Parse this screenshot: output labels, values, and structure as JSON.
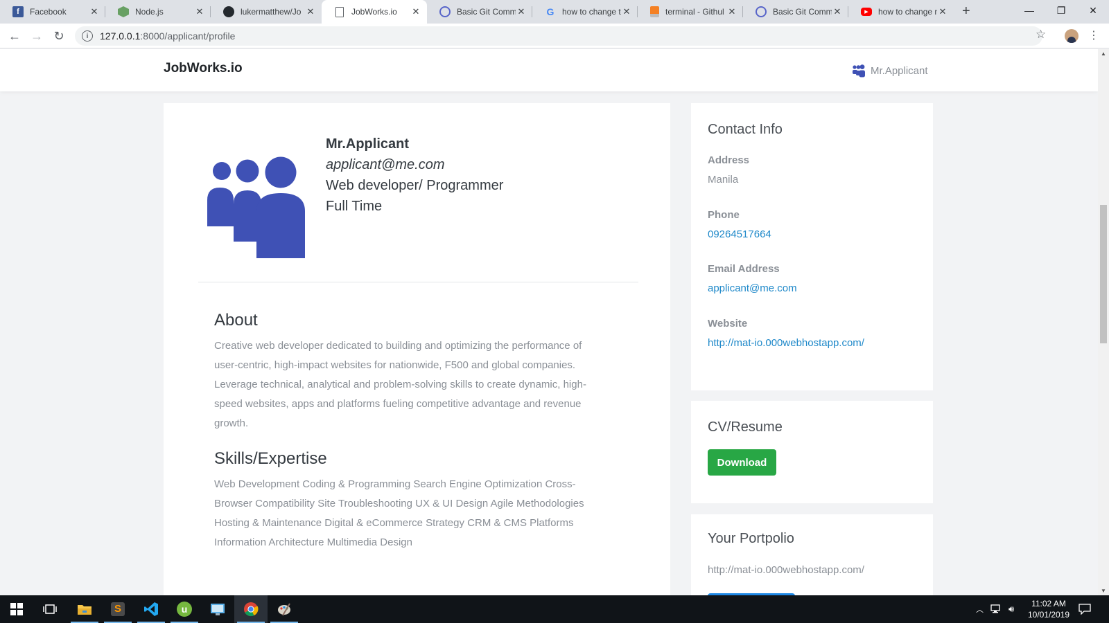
{
  "browser": {
    "tabs": [
      {
        "title": "Facebook",
        "icon": "facebook-icon"
      },
      {
        "title": "Node.js",
        "icon": "nodejs-icon"
      },
      {
        "title": "lukermatthew/Jo",
        "icon": "github-icon"
      },
      {
        "title": "JobWorks.io",
        "icon": "document-icon",
        "active": true
      },
      {
        "title": "Basic Git Comma",
        "icon": "circle-icon"
      },
      {
        "title": "how to change t",
        "icon": "google-icon"
      },
      {
        "title": "terminal - Githul",
        "icon": "stackoverflow-icon"
      },
      {
        "title": "Basic Git Comma",
        "icon": "circle-icon"
      },
      {
        "title": "how to change n",
        "icon": "youtube-icon"
      }
    ],
    "url_host": "127.0.0.1",
    "url_path": ":8000/applicant/profile"
  },
  "nav": {
    "brand": "JobWorks.io",
    "user": "Mr.Applicant"
  },
  "profile": {
    "name": "Mr.Applicant",
    "email": "applicant@me.com",
    "title": "Web developer/ Programmer",
    "type": "Full Time"
  },
  "about": {
    "heading": "About",
    "lines": [
      "Creative web developer dedicated to building and optimizing the performance of",
      "user-centric, high-impact websites for nationwide, F500 and global companies.",
      "Leverage technical, analytical and problem-solving skills to create dynamic, high-",
      "speed websites, apps and platforms fueling competitive advantage and revenue",
      "growth."
    ]
  },
  "skills": {
    "heading": "Skills/Expertise",
    "lines": [
      "Web Development Coding & Programming Search Engine Optimization Cross-",
      "Browser Compatibility Site Troubleshooting UX & UI Design Agile Methodologies",
      "Hosting & Maintenance Digital & eCommerce Strategy CRM & CMS Platforms",
      "Information Architecture Multimedia Design"
    ]
  },
  "contact": {
    "heading": "Contact Info",
    "address_label": "Address",
    "address": "Manila",
    "phone_label": "Phone",
    "phone": "09264517664",
    "email_label": "Email Address",
    "email": "applicant@me.com",
    "website_label": "Website",
    "website": "http://mat-io.000webhostapp.com/"
  },
  "cv": {
    "heading": "CV/Resume",
    "download_label": "Download"
  },
  "portfolio": {
    "heading": "Your Portpolio",
    "url": "http://mat-io.000webhostapp.com/"
  },
  "taskbar": {
    "time": "11:02 AM",
    "date": "10/01/2019"
  },
  "colors": {
    "brand_blue": "#3f51b5",
    "link": "#1e88c9",
    "download_green": "#28a745"
  }
}
